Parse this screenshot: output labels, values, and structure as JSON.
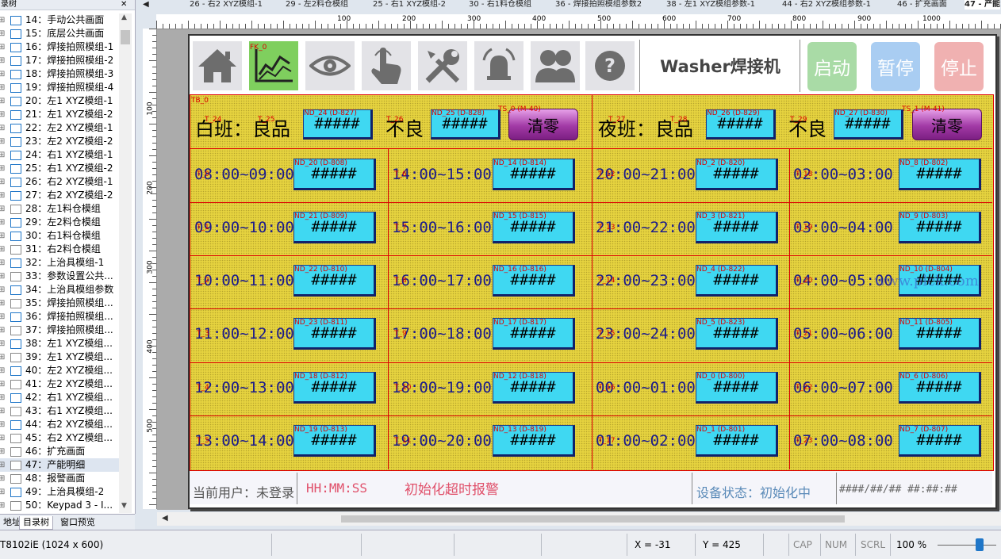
{
  "tree": {
    "header": "录树",
    "close": "✕",
    "items": [
      {
        "label": "14：手动公共画面",
        "blue": true
      },
      {
        "label": "15：底层公共画面",
        "blue": true
      },
      {
        "label": "16：焊接拍照模组-1",
        "blue": true
      },
      {
        "label": "17：焊接拍照模组-2",
        "blue": true
      },
      {
        "label": "18：焊接拍照模组-3",
        "blue": true
      },
      {
        "label": "19：焊接拍照模组-4",
        "blue": true
      },
      {
        "label": "20：左1 XYZ模组-1",
        "blue": true
      },
      {
        "label": "21：左1 XYZ模组-2",
        "blue": true
      },
      {
        "label": "22：左2 XYZ模组-1",
        "blue": true
      },
      {
        "label": "23：左2 XYZ模组-2",
        "blue": true
      },
      {
        "label": "24：右1 XYZ模组-1",
        "blue": true
      },
      {
        "label": "25：右1 XYZ模组-2",
        "blue": true
      },
      {
        "label": "26：右2 XYZ模组-1",
        "blue": true
      },
      {
        "label": "27：右2 XYZ模组-2",
        "blue": true
      },
      {
        "label": "28：左1料仓模组",
        "blue": false
      },
      {
        "label": "29：左2料仓模组",
        "blue": true
      },
      {
        "label": "30：右1料仓模组",
        "blue": true
      },
      {
        "label": "31：右2料仓模组",
        "blue": false
      },
      {
        "label": "32：上治具模组-1",
        "blue": true
      },
      {
        "label": "33：参数设置公共...",
        "blue": false
      },
      {
        "label": "34：上治具模组参数",
        "blue": true
      },
      {
        "label": "35：焊接拍照模组...",
        "blue": false
      },
      {
        "label": "36：焊接拍照模组...",
        "blue": true
      },
      {
        "label": "37：焊接拍照模组...",
        "blue": false
      },
      {
        "label": "38：左1 XYZ模组...",
        "blue": true
      },
      {
        "label": "39：左1 XYZ模组...",
        "blue": false
      },
      {
        "label": "40：左2 XYZ模组...",
        "blue": true
      },
      {
        "label": "41：左2 XYZ模组...",
        "blue": false
      },
      {
        "label": "42：右1 XYZ模组...",
        "blue": true
      },
      {
        "label": "43：右1 XYZ模组...",
        "blue": false
      },
      {
        "label": "44：右2 XYZ模组...",
        "blue": true
      },
      {
        "label": "45：右2 XYZ模组...",
        "blue": false
      },
      {
        "label": "46：扩充画面",
        "blue": false
      },
      {
        "label": "47：产能明细",
        "blue": false,
        "selected": true
      },
      {
        "label": "48：报警画面",
        "blue": false
      },
      {
        "label": "49：上治具模组-2",
        "blue": true
      },
      {
        "label": "50：Keypad 3 - I...",
        "blue": false
      }
    ],
    "bottom_tabs": [
      "地址",
      "目录树",
      "窗口预览"
    ]
  },
  "doc_tabs": [
    "26 - 右2 XYZ模组-1",
    "29 - 左2料仓模组",
    "25 - 右1 XYZ模组-2",
    "30 - 右1料仓模组",
    "36 - 焊接拍照模组参数2",
    "38 - 左1 XYZ模组参数-1",
    "44 - 右2 XYZ模组参数-1",
    "46 - 扩充画面",
    "47 - 产能"
  ],
  "ruler_top": [
    "100",
    "200",
    "300",
    "400",
    "500",
    "600",
    "700",
    "800",
    "900",
    "1000"
  ],
  "ruler_left": [
    "100",
    "200",
    "300",
    "400",
    "500"
  ],
  "hmi": {
    "fk_tag": "FK_0",
    "tb_tag": "TB_0",
    "title": "Washer焊接机",
    "buttons": {
      "start": "启动",
      "pause": "暂停",
      "stop": "停止"
    },
    "colors": {
      "start": "#a9dba6",
      "pause": "#a9cdf2",
      "stop": "#f0b1b1",
      "grid": "#e6d33f",
      "cell": "#3fd8f2"
    },
    "day_label": "白班：良品",
    "night_label": "夜班：良品",
    "bad_label": "不良",
    "clear_label": "清零",
    "mask": "#####",
    "tags": {
      "day_good": "ND_24 (D-827)",
      "day_bad": "ND_25 (D-828)",
      "day_clear": "TS_0 (M-40)",
      "night_good": "ND_26 (D-829)",
      "night_bad": "ND_27 (D-830)",
      "night_clear": "TS_1 (M-41)",
      "t24": "T_24",
      "t25": "T_25",
      "t26": "T_26",
      "t27": "T_27",
      "t28": "T_28",
      "t29": "T_29"
    },
    "rows": [
      [
        {
          "time": "08:00~09:00",
          "tag": "ND_20 (D-808)",
          "t": "T_0"
        },
        {
          "time": "14:00~15:00",
          "tag": "ND_14 (D-814)",
          "t": "T_6"
        },
        {
          "time": "20:00~21:00",
          "tag": "ND_2 (D-820)",
          "t": "T_12"
        },
        {
          "time": "02:00~03:00",
          "tag": "ND_8 (D-802)",
          "t": "T_18"
        }
      ],
      [
        {
          "time": "09:00~10:00",
          "tag": "ND_21 (D-809)",
          "t": "T_1"
        },
        {
          "time": "15:00~16:00",
          "tag": "ND_15 (D-815)",
          "t": "T_7"
        },
        {
          "time": "21:00~22:00",
          "tag": "ND_3 (D-821)",
          "t": "T_13"
        },
        {
          "time": "03:00~04:00",
          "tag": "ND_9 (D-803)",
          "t": "T_19"
        }
      ],
      [
        {
          "time": "10:00~11:00",
          "tag": "ND_22 (D-810)",
          "t": "T_2"
        },
        {
          "time": "16:00~17:00",
          "tag": "ND_16 (D-816)",
          "t": "T_8"
        },
        {
          "time": "22:00~23:00",
          "tag": "ND_4 (D-822)",
          "t": "T_14"
        },
        {
          "time": "04:00~05:00",
          "tag": "ND_10 (D-804)",
          "t": "T_20"
        }
      ],
      [
        {
          "time": "11:00~12:00",
          "tag": "ND_23 (D-811)",
          "t": "T_3"
        },
        {
          "time": "17:00~18:00",
          "tag": "ND_17 (D-817)",
          "t": "T_9"
        },
        {
          "time": "23:00~24:00",
          "tag": "ND_5 (D-823)",
          "t": "T_15"
        },
        {
          "time": "05:00~06:00",
          "tag": "ND_11 (D-805)",
          "t": "T_21"
        }
      ],
      [
        {
          "time": "12:00~13:00",
          "tag": "ND_18 (D-812)",
          "t": "T_4"
        },
        {
          "time": "18:00~19:00",
          "tag": "ND_12 (D-818)",
          "t": "T_10"
        },
        {
          "time": "00:00~01:00",
          "tag": "ND_0 (D-800)",
          "t": "T_16"
        },
        {
          "time": "06:00~07:00",
          "tag": "ND_6 (D-806)",
          "t": "T_22"
        }
      ],
      [
        {
          "time": "13:00~14:00",
          "tag": "ND_19 (D-813)",
          "t": "T_5"
        },
        {
          "time": "19:00~20:00",
          "tag": "ND_13 (D-819)",
          "t": "T_11"
        },
        {
          "time": "01:00~02:00",
          "tag": "ND_1 (D-801)",
          "t": "T_17"
        },
        {
          "time": "07:00~08:00",
          "tag": "ND_7 (D-807)",
          "t": "T_23"
        }
      ]
    ],
    "watermark": "www.plck.com",
    "bottom": {
      "user": "当前用户：未登录",
      "time": "HH:MM:SS",
      "alarm": "初始化超时报警",
      "status": "设备状态：初始化中",
      "datetime": "####/##/## ##:##:##"
    }
  },
  "status": {
    "model": "T8102iE (1024 x 600)",
    "x": "X = -31",
    "y": "Y = 425",
    "caps": "CAP",
    "num": "NUM",
    "scrl": "SCRL",
    "zoom": "100 %"
  }
}
